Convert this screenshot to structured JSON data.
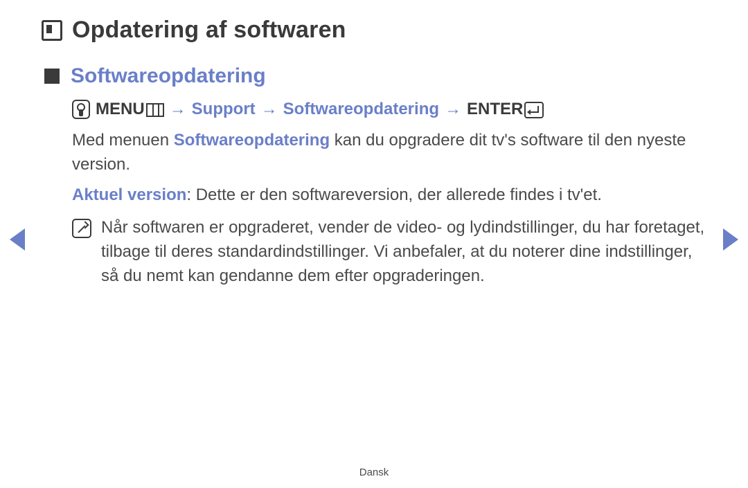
{
  "page": {
    "h1": "Opdatering af softwaren",
    "h2": "Softwareopdatering",
    "path": {
      "menu_label": "MENU",
      "arrow": "→",
      "support": "Support",
      "softwareupdate": "Softwareopdatering",
      "enter_label": "ENTER"
    },
    "para1_a": "Med menuen ",
    "para1_link": "Softwareopdatering",
    "para1_b": " kan du opgradere dit tv's software til den nyeste version.",
    "para2_label": "Aktuel version",
    "para2_rest": ": Dette er den softwareversion, der allerede findes i tv'et.",
    "note": "Når softwaren er opgraderet, vender de video- og lydindstillinger, du har foretaget, tilbage til deres standardindstillinger. Vi anbefaler, at du noterer dine indstillinger, så du nemt kan gendanne dem efter opgraderingen.",
    "footer_lang": "Dansk"
  }
}
